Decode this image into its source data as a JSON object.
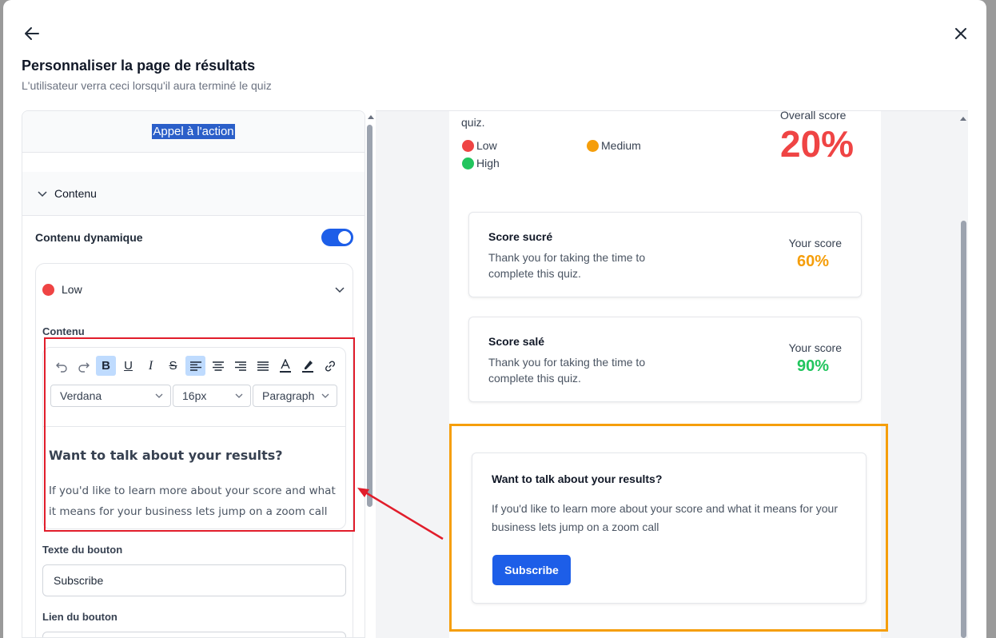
{
  "modal": {
    "title": "Personnaliser la page de résultats",
    "subtitle": "L'utilisateur verra ceci lorsqu'il aura terminé le quiz"
  },
  "left": {
    "header_label": "Appel à l'action",
    "section_label": "Contenu",
    "dynamic_label": "Contenu dynamique",
    "dynamic_enabled": true,
    "level_label": "Low",
    "content_label": "Contenu",
    "font_select": "Verdana",
    "size_select": "16px",
    "block_select": "Paragraph",
    "editor_heading": "Want to talk about your results?",
    "editor_body": "If you'd like to learn more about your score and what it means for your business lets jump on a zoom call",
    "button_text_label": "Texte du bouton",
    "button_text_value": "Subscribe",
    "button_link_label": "Lien du bouton"
  },
  "preview": {
    "quiz_fragment": "quiz.",
    "legend": [
      {
        "label": "Low",
        "color": "#ef4444"
      },
      {
        "label": "Medium",
        "color": "#f59e0b"
      },
      {
        "label": "High",
        "color": "#22c55e"
      }
    ],
    "overall_label": "Overall score",
    "overall_value": "20%",
    "scores": [
      {
        "title": "Score sucré",
        "desc": "Thank you for taking the time to complete this quiz.",
        "your_label": "Your score",
        "value": "60%",
        "color": "#f59e0b"
      },
      {
        "title": "Score salé",
        "desc": "Thank you for taking the time to complete this quiz.",
        "your_label": "Your score",
        "value": "90%",
        "color": "#22c55e"
      }
    ],
    "cta_title": "Want to talk about your results?",
    "cta_text": "If you'd like to learn more about your score and what it means for your business lets jump on a zoom call",
    "cta_button": "Subscribe"
  },
  "colors": {
    "accent": "#1d5ee8",
    "low": "#ef4444",
    "medium": "#f59e0b",
    "high": "#22c55e"
  }
}
